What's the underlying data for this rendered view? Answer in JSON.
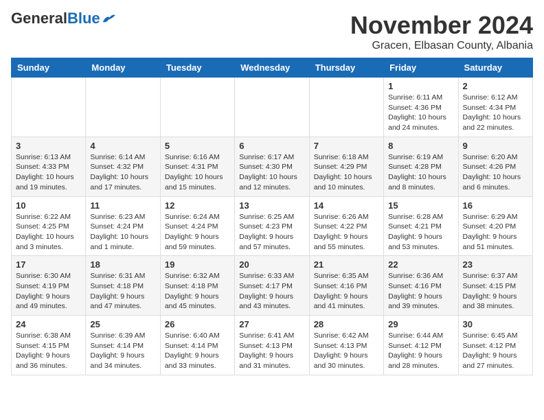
{
  "logo": {
    "general": "General",
    "blue": "Blue"
  },
  "header": {
    "month_title": "November 2024",
    "subtitle": "Gracen, Elbasan County, Albania"
  },
  "days_of_week": [
    "Sunday",
    "Monday",
    "Tuesday",
    "Wednesday",
    "Thursday",
    "Friday",
    "Saturday"
  ],
  "weeks": [
    [
      {
        "day": "",
        "info": ""
      },
      {
        "day": "",
        "info": ""
      },
      {
        "day": "",
        "info": ""
      },
      {
        "day": "",
        "info": ""
      },
      {
        "day": "",
        "info": ""
      },
      {
        "day": "1",
        "info": "Sunrise: 6:11 AM\nSunset: 4:36 PM\nDaylight: 10 hours and 24 minutes."
      },
      {
        "day": "2",
        "info": "Sunrise: 6:12 AM\nSunset: 4:34 PM\nDaylight: 10 hours and 22 minutes."
      }
    ],
    [
      {
        "day": "3",
        "info": "Sunrise: 6:13 AM\nSunset: 4:33 PM\nDaylight: 10 hours and 19 minutes."
      },
      {
        "day": "4",
        "info": "Sunrise: 6:14 AM\nSunset: 4:32 PM\nDaylight: 10 hours and 17 minutes."
      },
      {
        "day": "5",
        "info": "Sunrise: 6:16 AM\nSunset: 4:31 PM\nDaylight: 10 hours and 15 minutes."
      },
      {
        "day": "6",
        "info": "Sunrise: 6:17 AM\nSunset: 4:30 PM\nDaylight: 10 hours and 12 minutes."
      },
      {
        "day": "7",
        "info": "Sunrise: 6:18 AM\nSunset: 4:29 PM\nDaylight: 10 hours and 10 minutes."
      },
      {
        "day": "8",
        "info": "Sunrise: 6:19 AM\nSunset: 4:28 PM\nDaylight: 10 hours and 8 minutes."
      },
      {
        "day": "9",
        "info": "Sunrise: 6:20 AM\nSunset: 4:26 PM\nDaylight: 10 hours and 6 minutes."
      }
    ],
    [
      {
        "day": "10",
        "info": "Sunrise: 6:22 AM\nSunset: 4:25 PM\nDaylight: 10 hours and 3 minutes."
      },
      {
        "day": "11",
        "info": "Sunrise: 6:23 AM\nSunset: 4:24 PM\nDaylight: 10 hours and 1 minute."
      },
      {
        "day": "12",
        "info": "Sunrise: 6:24 AM\nSunset: 4:24 PM\nDaylight: 9 hours and 59 minutes."
      },
      {
        "day": "13",
        "info": "Sunrise: 6:25 AM\nSunset: 4:23 PM\nDaylight: 9 hours and 57 minutes."
      },
      {
        "day": "14",
        "info": "Sunrise: 6:26 AM\nSunset: 4:22 PM\nDaylight: 9 hours and 55 minutes."
      },
      {
        "day": "15",
        "info": "Sunrise: 6:28 AM\nSunset: 4:21 PM\nDaylight: 9 hours and 53 minutes."
      },
      {
        "day": "16",
        "info": "Sunrise: 6:29 AM\nSunset: 4:20 PM\nDaylight: 9 hours and 51 minutes."
      }
    ],
    [
      {
        "day": "17",
        "info": "Sunrise: 6:30 AM\nSunset: 4:19 PM\nDaylight: 9 hours and 49 minutes."
      },
      {
        "day": "18",
        "info": "Sunrise: 6:31 AM\nSunset: 4:18 PM\nDaylight: 9 hours and 47 minutes."
      },
      {
        "day": "19",
        "info": "Sunrise: 6:32 AM\nSunset: 4:18 PM\nDaylight: 9 hours and 45 minutes."
      },
      {
        "day": "20",
        "info": "Sunrise: 6:33 AM\nSunset: 4:17 PM\nDaylight: 9 hours and 43 minutes."
      },
      {
        "day": "21",
        "info": "Sunrise: 6:35 AM\nSunset: 4:16 PM\nDaylight: 9 hours and 41 minutes."
      },
      {
        "day": "22",
        "info": "Sunrise: 6:36 AM\nSunset: 4:16 PM\nDaylight: 9 hours and 39 minutes."
      },
      {
        "day": "23",
        "info": "Sunrise: 6:37 AM\nSunset: 4:15 PM\nDaylight: 9 hours and 38 minutes."
      }
    ],
    [
      {
        "day": "24",
        "info": "Sunrise: 6:38 AM\nSunset: 4:15 PM\nDaylight: 9 hours and 36 minutes."
      },
      {
        "day": "25",
        "info": "Sunrise: 6:39 AM\nSunset: 4:14 PM\nDaylight: 9 hours and 34 minutes."
      },
      {
        "day": "26",
        "info": "Sunrise: 6:40 AM\nSunset: 4:14 PM\nDaylight: 9 hours and 33 minutes."
      },
      {
        "day": "27",
        "info": "Sunrise: 6:41 AM\nSunset: 4:13 PM\nDaylight: 9 hours and 31 minutes."
      },
      {
        "day": "28",
        "info": "Sunrise: 6:42 AM\nSunset: 4:13 PM\nDaylight: 9 hours and 30 minutes."
      },
      {
        "day": "29",
        "info": "Sunrise: 6:44 AM\nSunset: 4:12 PM\nDaylight: 9 hours and 28 minutes."
      },
      {
        "day": "30",
        "info": "Sunrise: 6:45 AM\nSunset: 4:12 PM\nDaylight: 9 hours and 27 minutes."
      }
    ]
  ]
}
